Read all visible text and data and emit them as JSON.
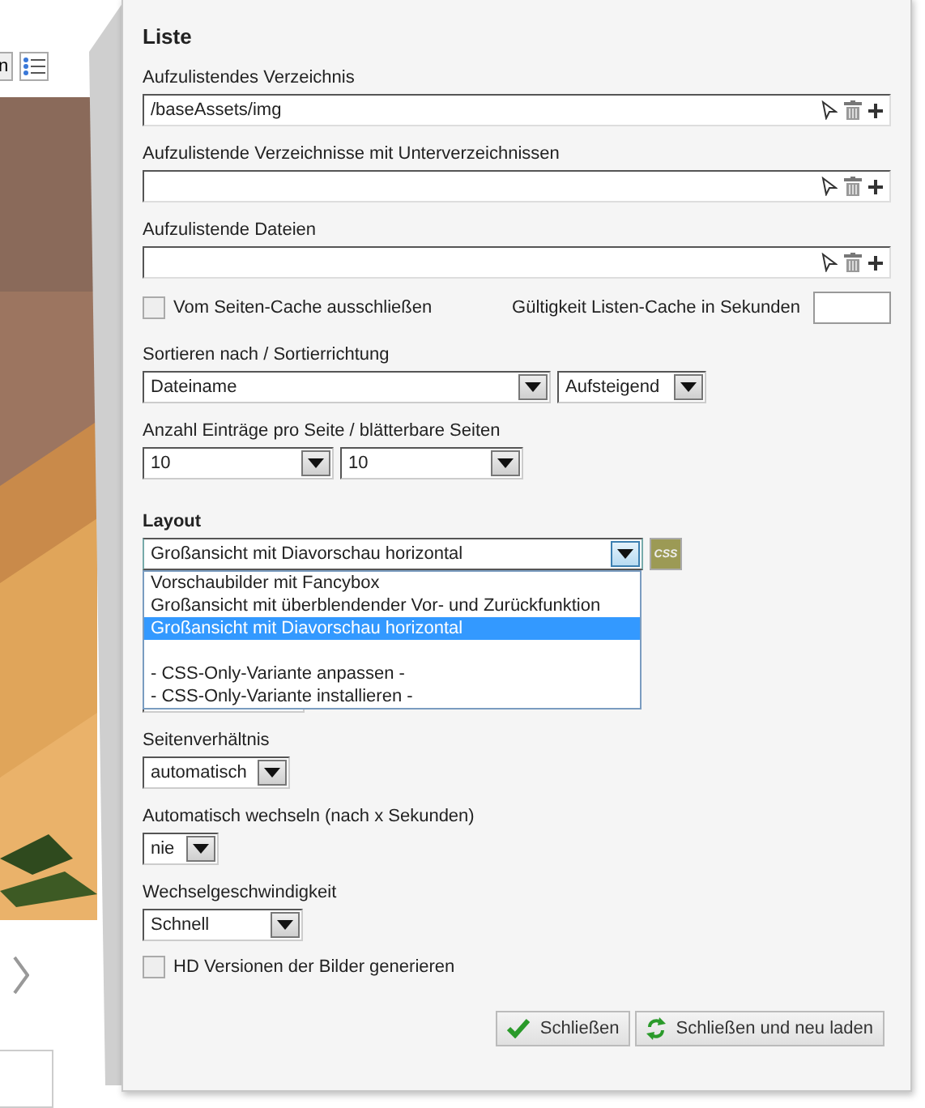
{
  "background": {
    "toolbar_button": "n"
  },
  "panel": {
    "title": "Liste",
    "path_fields": [
      {
        "label": "Aufzulistendes Verzeichnis",
        "value": "/baseAssets/img"
      },
      {
        "label": "Aufzulistende Verzeichnisse mit Unterverzeichnissen"
      },
      {
        "label": "Aufzulistende Dateien"
      }
    ],
    "exclude_cache": {
      "label": "Vom Seiten-Cache ausschließen",
      "checked": false
    },
    "cache_validity": {
      "label": "Gültigkeit Listen-Cache in Sekunden"
    },
    "sort": {
      "label": "Sortieren nach / Sortierrichtung",
      "selects": [
        "Dateiname",
        "Aufsteigend"
      ]
    },
    "paging": {
      "label": "Anzahl Einträge pro Seite / blätterbare Seiten",
      "selects": [
        "10",
        "10"
      ]
    },
    "layout": {
      "label": "Layout",
      "value": "Großansicht mit Diavorschau horizontal",
      "css_button": "CSS",
      "expanded": true,
      "options": [
        {
          "kind": "option",
          "label": "Vorschaubilder mit Fancybox",
          "selected": false
        },
        {
          "kind": "option",
          "label": "Großansicht mit überblendender Vor- und Zurückfunktion",
          "selected": false
        },
        {
          "kind": "option",
          "label": "Großansicht mit Diavorschau horizontal",
          "selected": true
        },
        {
          "kind": "blank"
        },
        {
          "kind": "option",
          "label": "- CSS-Only-Variante anpassen -",
          "selected": false
        },
        {
          "kind": "option",
          "label": "- CSS-Only-Variante installieren -",
          "selected": false
        }
      ]
    },
    "more_selects": [
      {
        "label": "Seitenverhältnis",
        "value": "automatisch"
      },
      {
        "label": "Automatisch wechseln (nach x Sekunden)",
        "value": "nie"
      },
      {
        "label": "Wechselgeschwindigkeit",
        "value": "Schnell"
      }
    ],
    "hd_versions": {
      "label": "HD Versionen der Bilder generieren",
      "checked": false
    },
    "buttons": [
      {
        "kind": "check",
        "label": "Schließen"
      },
      {
        "kind": "reload",
        "label": "Schließen und neu laden"
      }
    ]
  }
}
